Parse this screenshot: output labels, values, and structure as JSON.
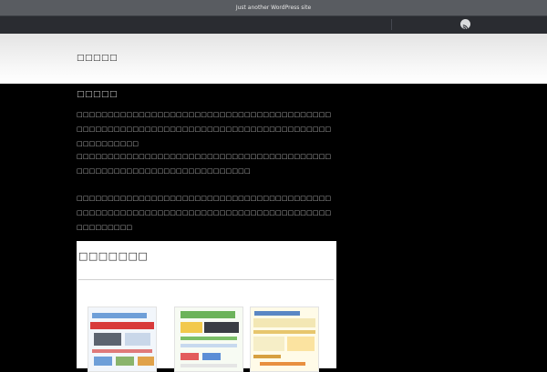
{
  "topbar": {
    "tagline": "Just another WordPress site"
  },
  "navbar": {
    "rss_icon": "rss-icon"
  },
  "header": {
    "site_title": "□□□□□"
  },
  "main": {
    "heading": "□□□□□",
    "paragraphs": [
      "□□□□□□□□□□□□□□□□□□□□□□□□□□□□□□□□□□□□□□□□□□□□□□□□□□□□□□□□□□□□□□□□□□□□□□□□□□□□□□□□□□□□□□□□□□□□",
      "□□□□□□□□□□□□□□□□□□□□□□□□□□□□□□□□□□□□□□□□□□□□□□□□□□□□□□□□□□□□□□□□□□□□□",
      "□□□□□□□□□□□□□□□□□□□□□□□□□□□□□□□□□□□□□□□□□□□□□□□□□□□□□□□□□□□□□□□□□□□□□□□□□□□□□□□□□□□□□□□□□□□"
    ]
  },
  "gallery": {
    "title": "□□□□□□□",
    "thumbnails": [
      "thumbnail-1",
      "thumbnail-2",
      "thumbnail-3"
    ]
  },
  "colors": {
    "topbar_bg": "#595c61",
    "navbar_bg": "#2a2c31",
    "page_bg": "#000000",
    "body_text": "#bdbdbd"
  }
}
